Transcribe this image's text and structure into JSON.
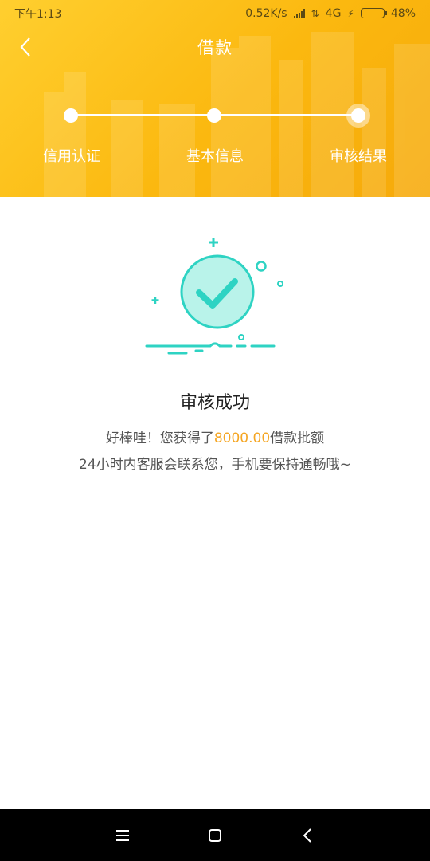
{
  "status_bar": {
    "time": "下午1:13",
    "speed": "0.52K/s",
    "network": "4G",
    "battery": "48%"
  },
  "nav": {
    "title": "借款"
  },
  "steps": [
    {
      "label": "信用认证"
    },
    {
      "label": "基本信息"
    },
    {
      "label": "审核结果"
    }
  ],
  "result": {
    "title": "审核成功",
    "line1_prefix": "好棒哇！您获得了",
    "amount": "8000.00",
    "line1_suffix": "借款批额",
    "line2": "24小时内客服会联系您，手机要保持通畅哦~"
  },
  "colors": {
    "header_start": "#ffcf2f",
    "header_end": "#f6a90a",
    "amount": "#f5a623",
    "check_teal": "#2ed3c3"
  },
  "icons": {
    "back": "chevron-left-icon",
    "check": "check-circle-icon",
    "menu": "menu-icon",
    "home": "home-icon",
    "nav_back": "back-icon"
  }
}
